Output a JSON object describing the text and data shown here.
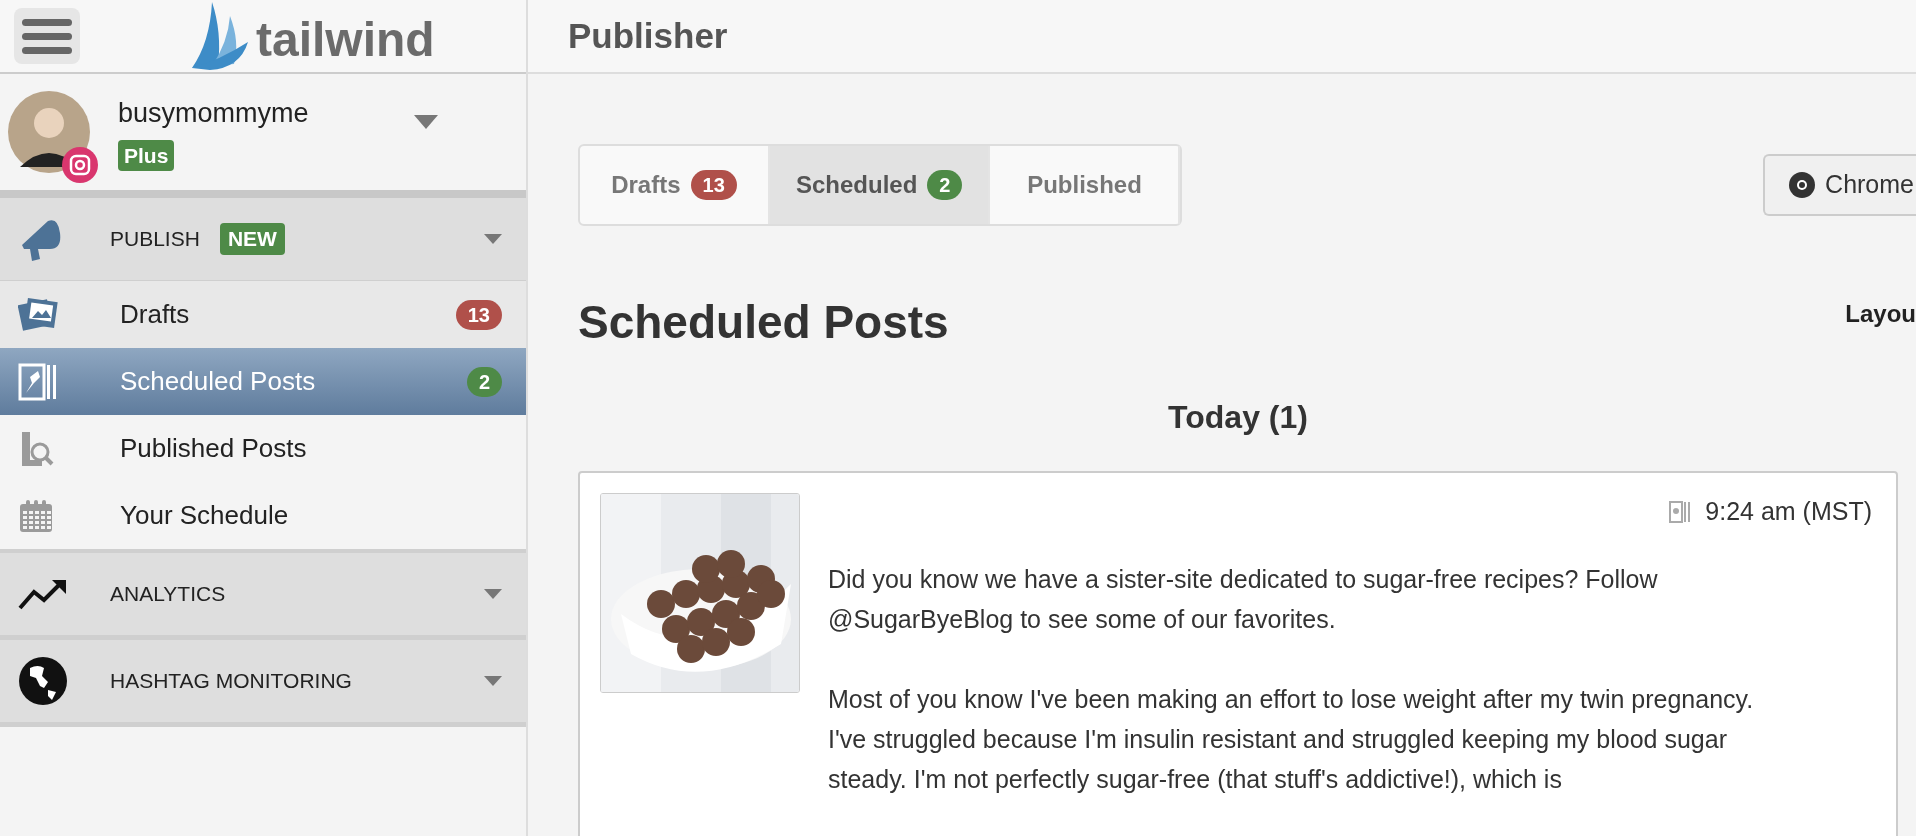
{
  "sidebar": {
    "logo": "tailwind",
    "account": {
      "name": "busymommyme",
      "plan": "Plus"
    },
    "sections": [
      {
        "label": "PUBLISH",
        "badge": "NEW",
        "kind": "megaphone",
        "items": [
          {
            "label": "Drafts",
            "kind": "photos",
            "count": "13",
            "color": "#b0504a",
            "selected": false
          },
          {
            "label": "Scheduled Posts",
            "kind": "pin",
            "count": "2",
            "color": "#4e8a47",
            "selected": true
          },
          {
            "label": "Published Posts",
            "kind": "search-doc",
            "selected": false
          },
          {
            "label": "Your Schedule",
            "kind": "calendar",
            "selected": false
          }
        ]
      },
      {
        "label": "ANALYTICS",
        "kind": "trend"
      },
      {
        "label": "HASHTAG MONITORING",
        "kind": "globe"
      }
    ]
  },
  "header": {
    "title": "Publisher"
  },
  "tabs": [
    {
      "label": "Drafts",
      "count": "13",
      "color": "#b0504a",
      "selected": false
    },
    {
      "label": "Scheduled",
      "count": "2",
      "color": "#4e8a47",
      "selected": true
    },
    {
      "label": "Published",
      "selected": false
    }
  ],
  "chrome_button": "Chrome",
  "heading": "Scheduled Posts",
  "layout_label": "Layou",
  "groups": [
    {
      "title": "Today (1)",
      "posts": [
        {
          "time": "9:24 am (MST)",
          "paragraphs": [
            "Did you know we have a sister-site dedicated to sugar-free recipes? Follow @SugarByeBlog to see some of our favorites.",
            "Most of you know I've been making an effort to lose weight after my twin pregnancy. I've struggled because I'm insulin resistant and struggled keeping my blood sugar steady. I'm not perfectly sugar-free (that stuff's addictive!), which is"
          ]
        }
      ]
    }
  ]
}
